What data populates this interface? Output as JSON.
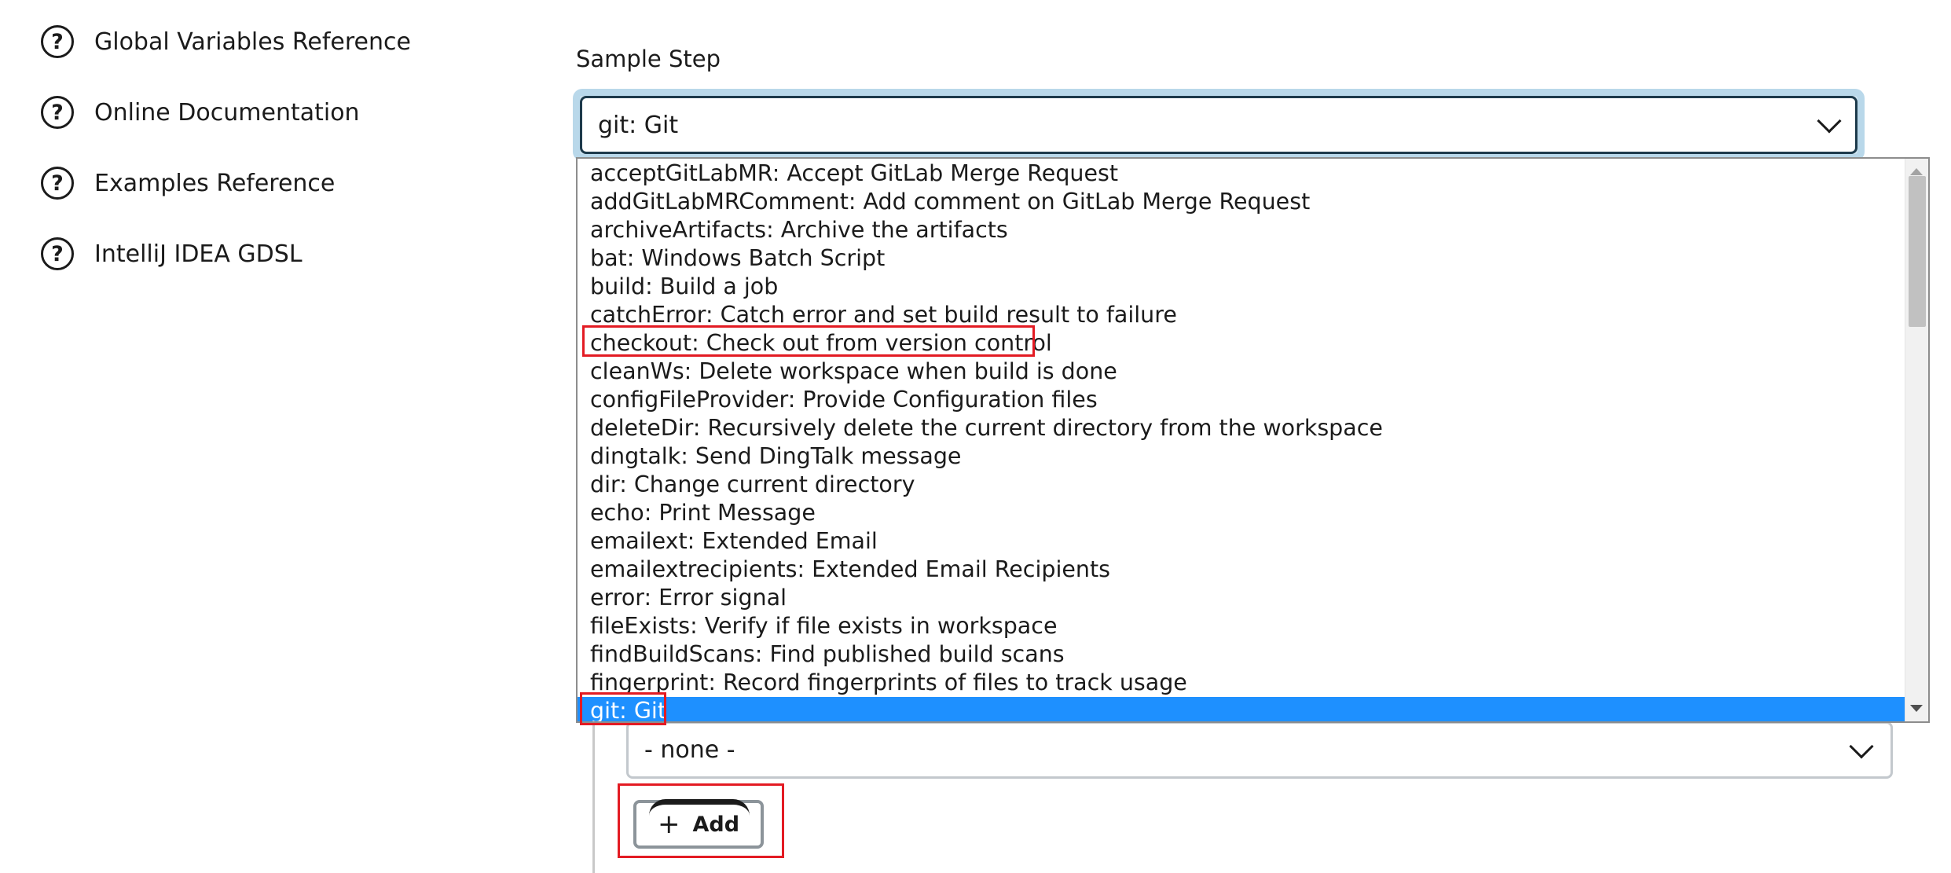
{
  "sidebar": {
    "items": [
      {
        "label": "Global Variables Reference",
        "icon": "help-circle-icon"
      },
      {
        "label": "Online Documentation",
        "icon": "help-circle-icon"
      },
      {
        "label": "Examples Reference",
        "icon": "help-circle-icon"
      },
      {
        "label": "IntelliJ IDEA GDSL",
        "icon": "help-circle-icon"
      }
    ],
    "icon_glyph": "?"
  },
  "sample_step": {
    "label": "Sample Step",
    "selected_value": "git: Git"
  },
  "dropdown": {
    "options": [
      "acceptGitLabMR: Accept GitLab Merge Request",
      "addGitLabMRComment: Add comment on GitLab Merge Request",
      "archiveArtifacts: Archive the artifacts",
      "bat: Windows Batch Script",
      "build: Build a job",
      "catchError: Catch error and set build result to failure",
      "checkout: Check out from version control",
      "cleanWs: Delete workspace when build is done",
      "configFileProvider: Provide Configuration files",
      "deleteDir: Recursively delete the current directory from the workspace",
      "dingtalk: Send DingTalk message",
      "dir: Change current directory",
      "echo: Print Message",
      "emailext: Extended Email",
      "emailextrecipients: Extended Email Recipients",
      "error: Error signal",
      "fileExists: Verify if file exists in workspace",
      "findBuildScans: Find published build scans",
      "fingerprint: Record fingerprints of files to track usage",
      "git: Git"
    ],
    "selected_index": 19,
    "highlight_color": "#1e90ff"
  },
  "credentials_select": {
    "value": "- none -"
  },
  "add_button": {
    "icon_glyph": "+",
    "label": "Add"
  },
  "annotation_color": "#e31b23"
}
